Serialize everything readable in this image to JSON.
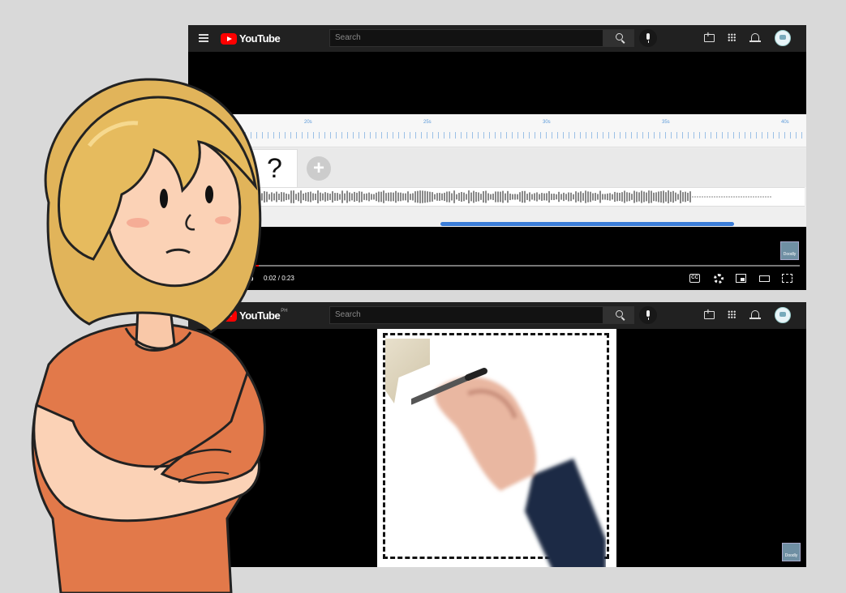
{
  "top_window": {
    "brand": "YouTube",
    "search_placeholder": "Search",
    "timeline_labels": [
      "20s",
      "25s",
      "30s",
      "35s",
      "40s"
    ],
    "question_mark": "?",
    "add_clip": "+",
    "time": "0:02 / 0:23",
    "progress": 0.05,
    "watermark": "Doodly",
    "cc_label": "CC"
  },
  "bottom_window": {
    "brand": "YouTube",
    "country": "PH",
    "search_placeholder": "Search",
    "watermark": "Doodly"
  },
  "colors": {
    "youtube_red": "#ff0000",
    "topbar": "#212121",
    "scrollbar": "#3b7dd8",
    "shirt": "#e2794a",
    "hair": "#e1b45a"
  }
}
